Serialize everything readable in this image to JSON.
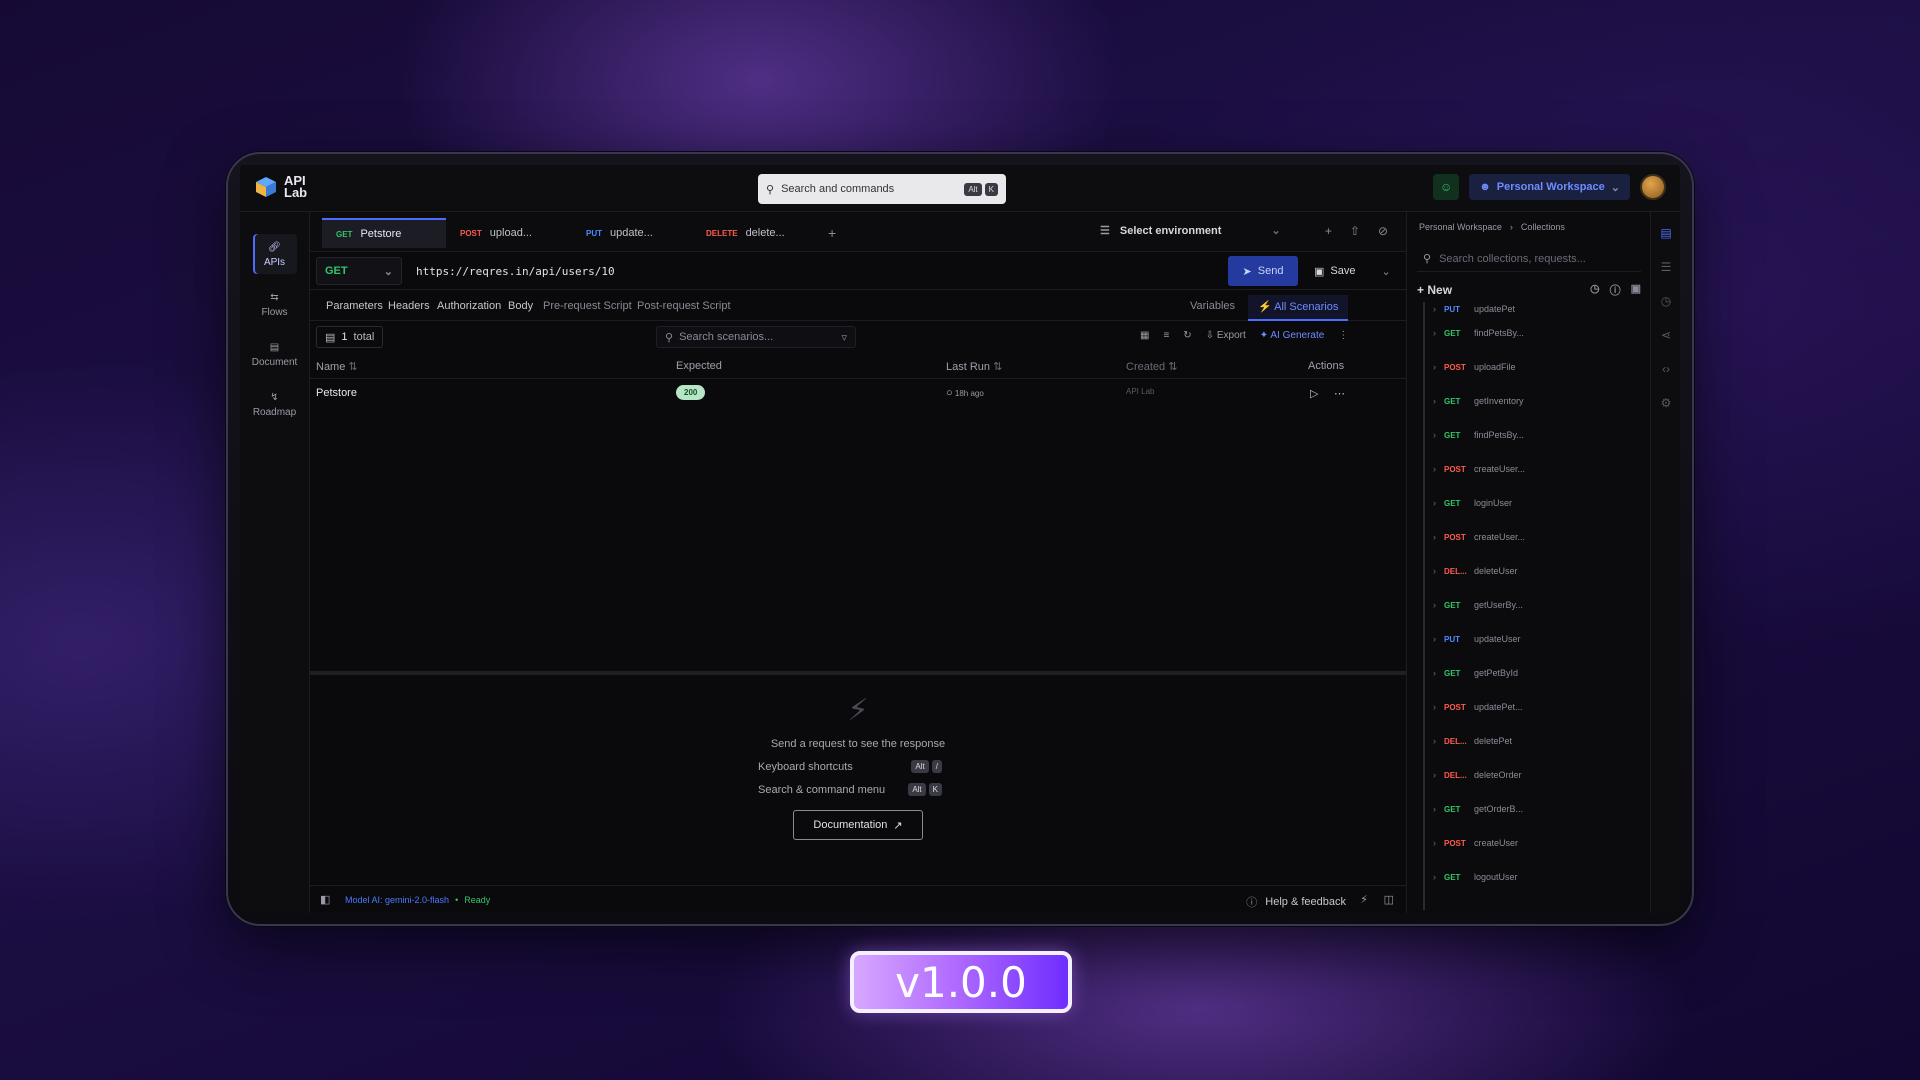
{
  "app": {
    "logo_text": "API Lab"
  },
  "topbar": {
    "search_placeholder": "Search and commands",
    "search_key1": "Alt",
    "search_key2": "K",
    "workspace": "Personal Workspace"
  },
  "rail": [
    {
      "label": "APIs",
      "icon": "link-icon"
    },
    {
      "label": "Flows",
      "icon": "flow-icon"
    },
    {
      "label": "Document",
      "icon": "document-icon"
    },
    {
      "label": "Roadmap",
      "icon": "roadmap-icon"
    }
  ],
  "tabs": [
    {
      "method": "GET",
      "label": "Petstore"
    },
    {
      "method": "POST",
      "label": "upload..."
    },
    {
      "method": "PUT",
      "label": "update..."
    },
    {
      "method": "DELETE",
      "label": "delete..."
    }
  ],
  "environment": {
    "label": "Select environment"
  },
  "request": {
    "method": "GET",
    "url": "https://reqres.in/api/users/10",
    "send_label": "Send",
    "save_label": "Save"
  },
  "subtabs": {
    "parameters": "Parameters",
    "headers": "Headers",
    "authorization": "Authorization",
    "body": "Body",
    "pre_request": "Pre-request Script",
    "post_request": "Post-request Script",
    "variables": "Variables",
    "all_scenarios": "⚡ All Scenarios"
  },
  "toolbar": {
    "count": "1",
    "count_label": "total",
    "search_placeholder": "Search scenarios...",
    "export_label": "Export",
    "ai_generate_label": "AI Generate"
  },
  "table": {
    "headers": {
      "name": "Name",
      "expected": "Expected",
      "last_run": "Last Run",
      "created": "Created",
      "actions": "Actions"
    },
    "rows": [
      {
        "name": "Petstore",
        "expected": "200",
        "last_run": "18h ago",
        "created": "API Lab"
      }
    ]
  },
  "response": {
    "prompt": "Send a request to see the response",
    "shortcuts_label": "Keyboard shortcuts",
    "shortcuts_key1": "Alt",
    "shortcuts_key2": "/",
    "command_menu_label": "Search & command menu",
    "command_key1": "Alt",
    "command_key2": "K",
    "documentation_label": "Documentation"
  },
  "statusbar": {
    "model": "Model AI: gemini-2.0-flash",
    "ready": "Ready",
    "help": "Help & feedback"
  },
  "collections": {
    "crumb_workspace": "Personal Workspace",
    "crumb_collections": "Collections",
    "search_placeholder": "Search collections, requests...",
    "new_label": "New",
    "items": [
      {
        "method": "PUT",
        "name": "updatePet"
      },
      {
        "method": "GET",
        "name": "findPetsBy..."
      },
      {
        "method": "POST",
        "name": "uploadFile"
      },
      {
        "method": "GET",
        "name": "getInventory"
      },
      {
        "method": "GET",
        "name": "findPetsBy..."
      },
      {
        "method": "POST",
        "name": "createUser..."
      },
      {
        "method": "GET",
        "name": "loginUser"
      },
      {
        "method": "POST",
        "name": "createUser..."
      },
      {
        "method": "DEL...",
        "name": "deleteUser"
      },
      {
        "method": "GET",
        "name": "getUserBy..."
      },
      {
        "method": "PUT",
        "name": "updateUser"
      },
      {
        "method": "GET",
        "name": "getPetById"
      },
      {
        "method": "POST",
        "name": "updatePet..."
      },
      {
        "method": "DEL...",
        "name": "deletePet"
      },
      {
        "method": "DEL...",
        "name": "deleteOrder"
      },
      {
        "method": "GET",
        "name": "getOrderB..."
      },
      {
        "method": "POST",
        "name": "createUser"
      },
      {
        "method": "GET",
        "name": "logoutUser"
      }
    ]
  },
  "colors": {
    "get": "#33c46a",
    "post": "#ff5b4d",
    "put": "#4c8cff",
    "delete": "#ff5b4d",
    "accent": "#4c6cff"
  },
  "version_badge": "v1.0.0"
}
